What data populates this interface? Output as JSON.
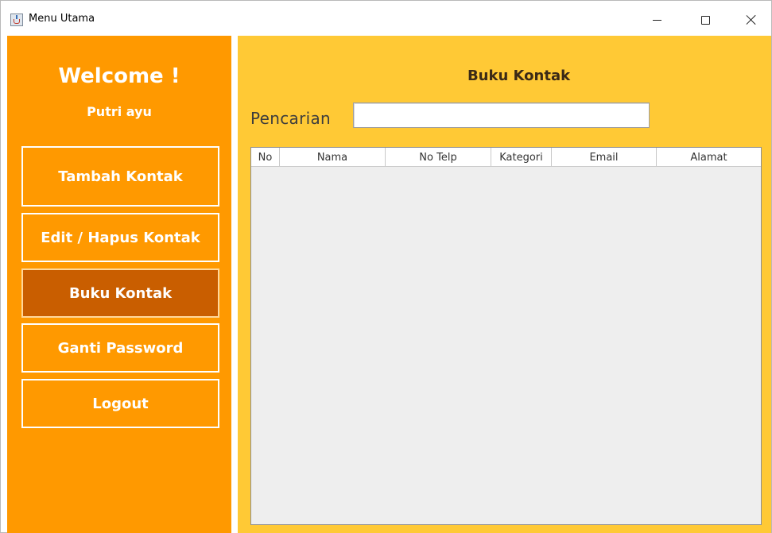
{
  "window": {
    "title": "Menu Utama"
  },
  "sidebar": {
    "welcome": "Welcome !",
    "username": "Putri ayu",
    "nav": [
      {
        "label": "Tambah Kontak",
        "active": false
      },
      {
        "label": "Edit / Hapus Kontak",
        "active": false
      },
      {
        "label": "Buku Kontak",
        "active": true
      },
      {
        "label": "Ganti Password",
        "active": false
      },
      {
        "label": "Logout",
        "active": false
      }
    ]
  },
  "main": {
    "title": "Buku Kontak",
    "search": {
      "label": "Pencarian",
      "value": ""
    },
    "table": {
      "columns": [
        "No",
        "Nama",
        "No Telp",
        "Kategori",
        "Email",
        "Alamat"
      ],
      "rows": []
    }
  },
  "colors": {
    "sidebar_bg": "#ff9900",
    "main_bg": "#ffc935",
    "active_nav": "#c95e00",
    "table_bg": "#eeeeee"
  },
  "icons": {
    "app": "java-coffee-icon",
    "minimize": "minimize-icon",
    "maximize": "maximize-icon",
    "close": "close-icon"
  }
}
